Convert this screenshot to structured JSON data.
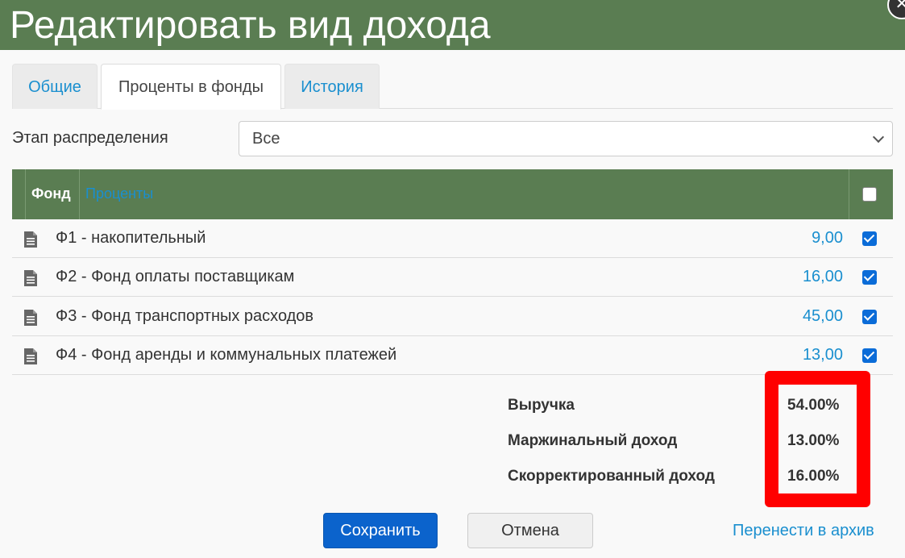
{
  "window": {
    "title": "Редактировать вид дохода"
  },
  "tabs": [
    {
      "label": "Общие"
    },
    {
      "label": "Проценты в фонды"
    },
    {
      "label": "История"
    }
  ],
  "stage": {
    "label": "Этап распределения",
    "value": "Все"
  },
  "table": {
    "headers": {
      "fund": "Фонд",
      "percent": "Проценты"
    },
    "header_checkbox_checked": false,
    "rows": [
      {
        "name": "Ф1 - накопительный",
        "value": "9,00",
        "checked": true
      },
      {
        "name": "Ф2 - Фонд оплаты поставщикам",
        "value": "16,00",
        "checked": true
      },
      {
        "name": "Ф3 - Фонд транспортных расходов",
        "value": "45,00",
        "checked": true
      },
      {
        "name": "Ф4 - Фонд аренды и коммунальных платежей",
        "value": "13,00",
        "checked": true
      }
    ]
  },
  "summary": [
    {
      "label": "Выручка",
      "value": "54.00%"
    },
    {
      "label": "Маржинальный доход",
      "value": "13.00%"
    },
    {
      "label": "Скорректированный доход",
      "value": "16.00%"
    }
  ],
  "actions": {
    "save": "Сохранить",
    "cancel": "Отмена",
    "archive": "Перенести в архив"
  },
  "colors": {
    "header": "#5a7d52",
    "link": "#1a8fcf",
    "primary": "#0b63cc",
    "highlight": "#ff0000"
  },
  "icons": {
    "close": "close-icon",
    "row": "document-icon",
    "select": "chevron-down-icon"
  }
}
